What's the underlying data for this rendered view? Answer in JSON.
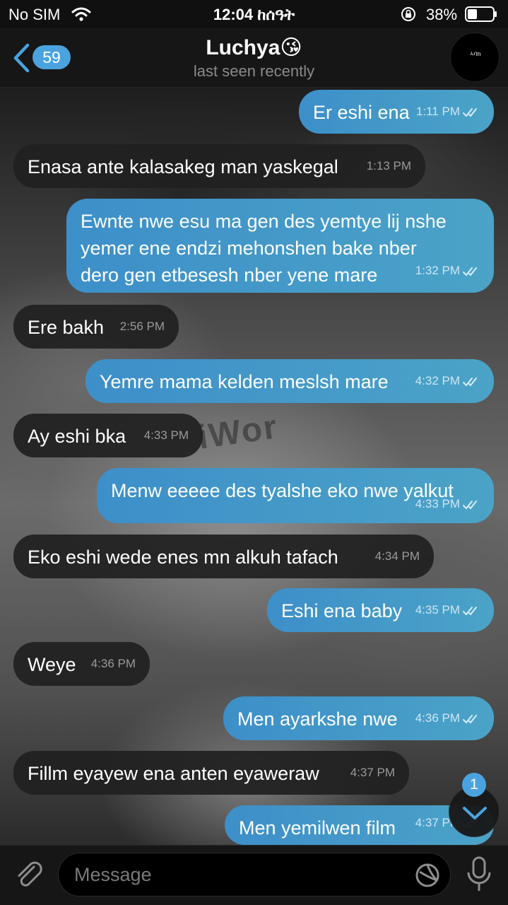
{
  "status_bar": {
    "carrier": "No SIM",
    "time": "12:04 ከሰዓት",
    "battery_percent": "38%",
    "battery_level": 0.38
  },
  "header": {
    "back_count": "59",
    "title": "Luchya😘",
    "subtitle": "last seen recently",
    "avatar_label": "ኣባክ"
  },
  "messages": [
    {
      "dir": "out",
      "text": "Er eshi ena",
      "time": "1:11 PM",
      "read": true
    },
    {
      "dir": "in",
      "text": "Enasa ante kalasakeg man yaskegal",
      "time": "1:13 PM"
    },
    {
      "dir": "out",
      "lines": [
        "Ewnte nwe esu ma gen des yemtye lij nshe",
        "yemer ene endzi mehonshen bake nber",
        "dero gen etbesesh nber yene mare"
      ],
      "time": "1:32 PM",
      "read": true
    },
    {
      "dir": "in",
      "text": "Ere bakh",
      "time": "2:56 PM"
    },
    {
      "dir": "out",
      "text": "Yemre mama kelden meslsh mare",
      "time": "4:32 PM",
      "read": true
    },
    {
      "dir": "in",
      "text": "Ay eshi bka",
      "time": "4:33 PM"
    },
    {
      "dir": "out",
      "text": "Menw eeeee des tyalshe eko nwe yalkut",
      "time": "4:33 PM",
      "read": true
    },
    {
      "dir": "in",
      "text": "Eko eshi wede enes mn alkuh tafach",
      "time": "4:34 PM"
    },
    {
      "dir": "out",
      "text": "Eshi ena baby",
      "time": "4:35 PM",
      "read": true
    },
    {
      "dir": "in",
      "text": "Weye",
      "time": "4:36 PM"
    },
    {
      "dir": "out",
      "text": "Men ayarkshe nwe",
      "time": "4:36 PM",
      "read": true
    },
    {
      "dir": "in",
      "text": "Fillm eyayew ena anten eyaweraw",
      "time": "4:37 PM"
    },
    {
      "dir": "out",
      "text": "Men yemilwen film",
      "time": "4:37 PM",
      "read": true
    }
  ],
  "scroll_down": {
    "unread": "1"
  },
  "input": {
    "placeholder": "Message"
  },
  "colors": {
    "accent": "#4aa3df",
    "outgoing_bubble": "#3d8fc9",
    "incoming_bubble": "#202020",
    "header_bg": "#161616"
  },
  "icons": [
    "wifi-icon",
    "lock-rotation-icon",
    "battery-icon",
    "back-chevron-icon",
    "double-check-icon",
    "chevron-down-icon",
    "paperclip-icon",
    "sticker-icon",
    "microphone-icon"
  ]
}
